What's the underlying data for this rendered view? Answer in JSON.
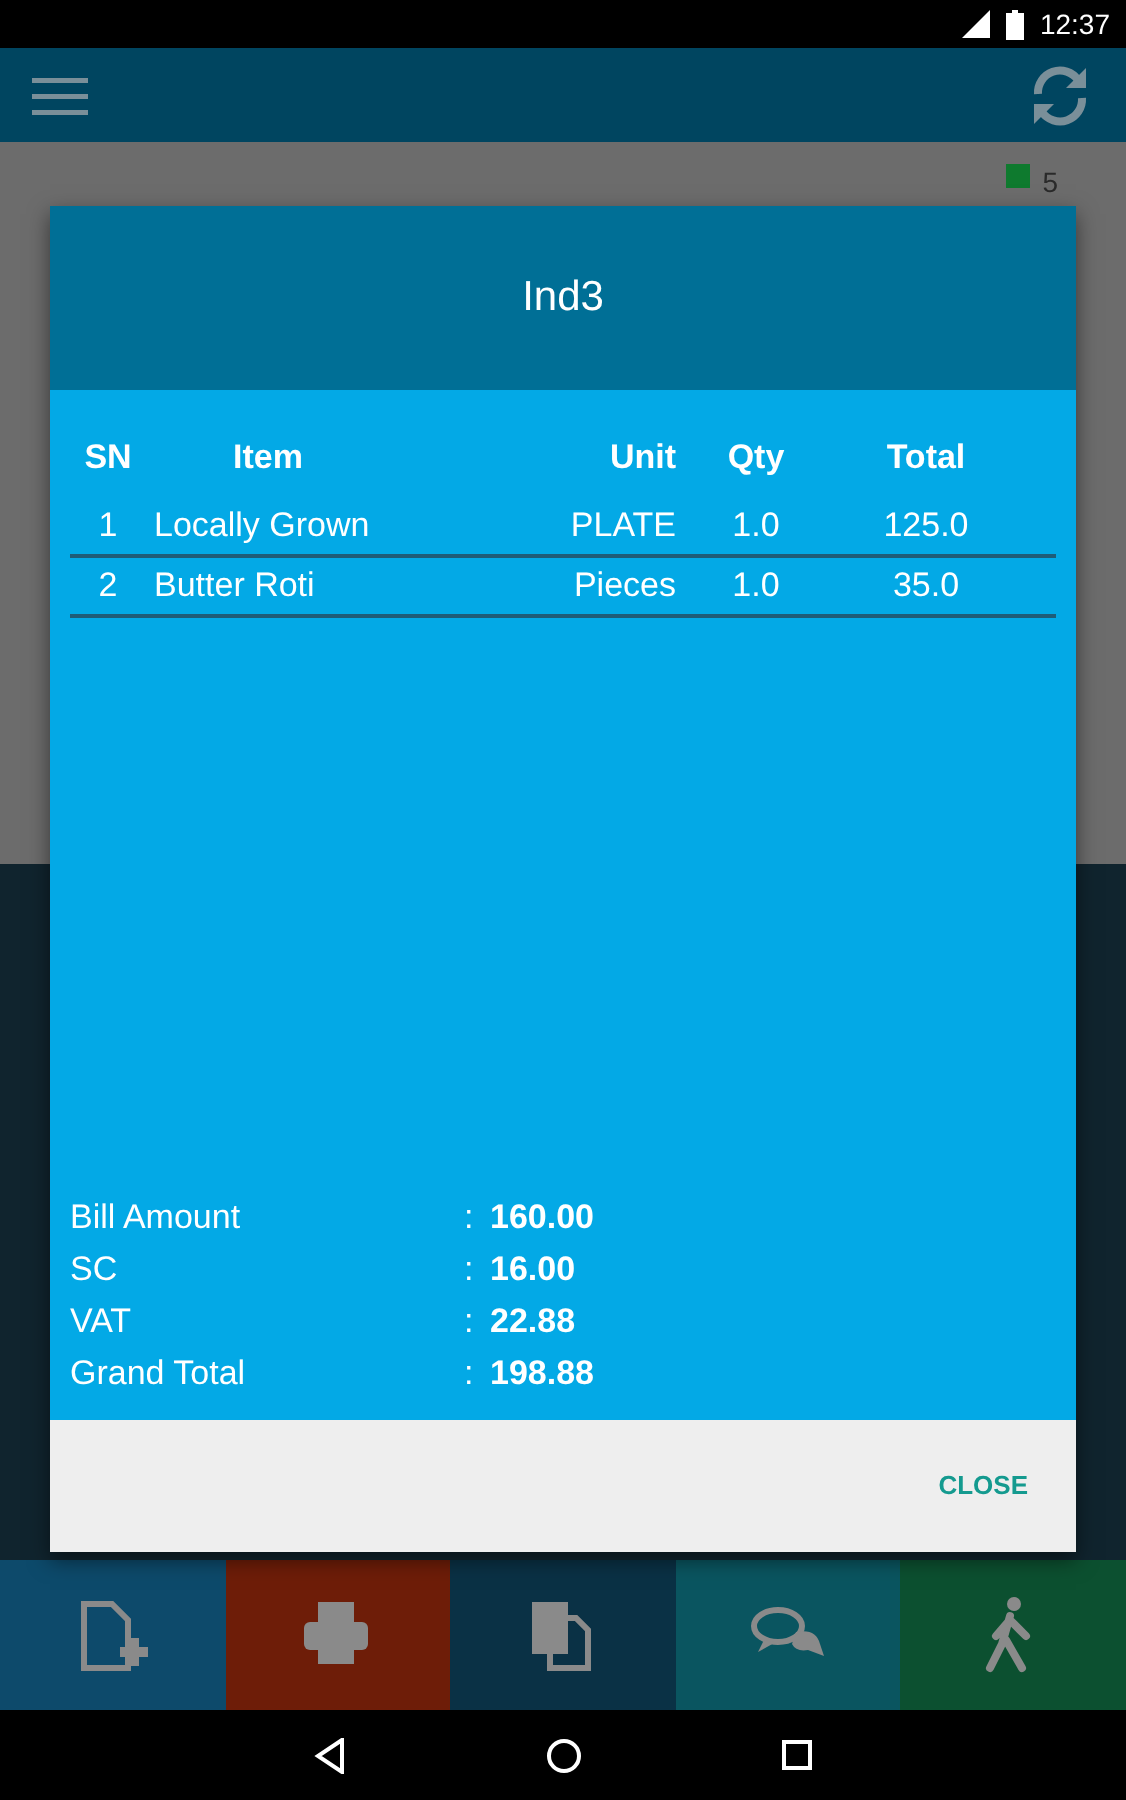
{
  "status_bar": {
    "time": "12:37"
  },
  "legend": {
    "count": "5",
    "color": "#0e7a2e"
  },
  "dialog": {
    "title": "Ind3",
    "columns": [
      "SN",
      "Item",
      "Unit",
      "Qty",
      "Total"
    ],
    "rows": [
      {
        "cells": [
          "1",
          "Locally Grown",
          "PLATE",
          "1.0",
          "125.0"
        ]
      },
      {
        "cells": [
          "2",
          "Butter Roti",
          "Pieces",
          "1.0",
          "35.0"
        ]
      }
    ],
    "summary": [
      {
        "label": "Bill Amount",
        "separator": ":",
        "value": "160.00"
      },
      {
        "label": "SC",
        "separator": ":",
        "value": "16.00"
      },
      {
        "label": "VAT",
        "separator": ":",
        "value": "22.88"
      },
      {
        "label": "Grand Total",
        "separator": ":",
        "value": "198.88"
      }
    ],
    "close_button": "CLOSE"
  },
  "toolbar": [
    {
      "kind": "new-file",
      "color": "#0d4a6b"
    },
    {
      "kind": "print",
      "color": "#6e1d08"
    },
    {
      "kind": "copy",
      "color": "#0a3145"
    },
    {
      "kind": "chat",
      "color": "#0a5560"
    },
    {
      "kind": "walk",
      "color": "#0c5030"
    }
  ]
}
